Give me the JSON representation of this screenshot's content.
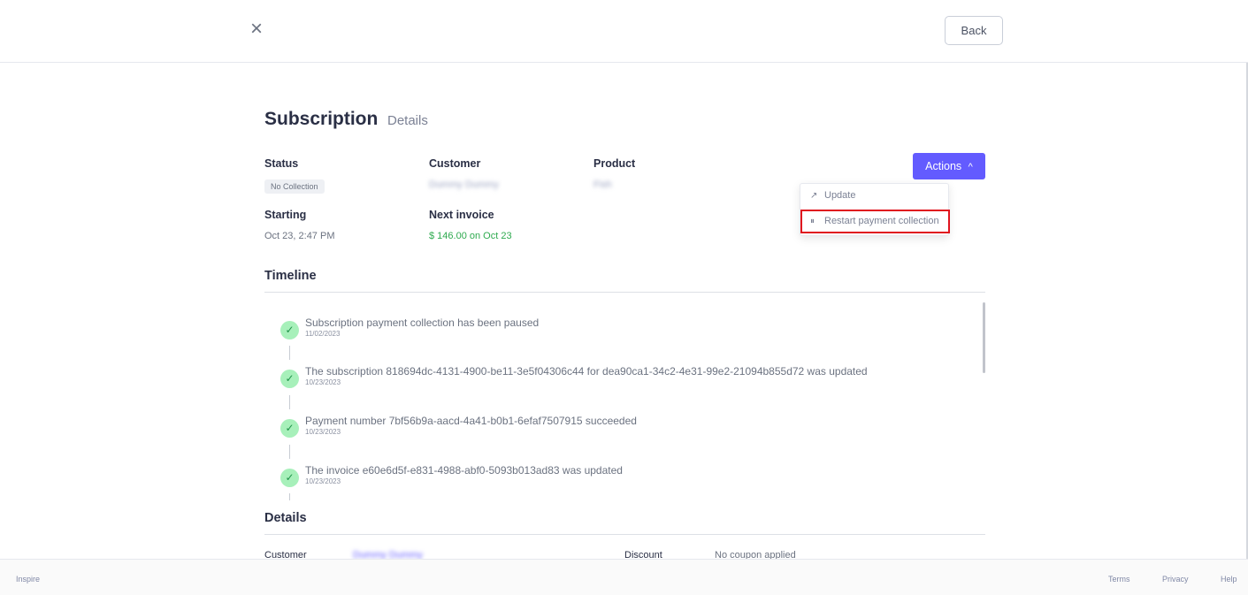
{
  "header": {
    "close_icon": "×",
    "back_label": "Back"
  },
  "page": {
    "title": "Subscription",
    "subtitle": "Details"
  },
  "fields": {
    "status": {
      "label": "Status",
      "value": "No Collection"
    },
    "customer": {
      "label": "Customer",
      "value": "Dummy Dummy"
    },
    "product": {
      "label": "Product",
      "value": "Fish"
    },
    "starting": {
      "label": "Starting",
      "value": "Oct 23, 2:47 PM"
    },
    "next_invoice": {
      "label": "Next invoice",
      "value": "$ 146.00 on Oct 23"
    }
  },
  "actions": {
    "button_label": "Actions",
    "chevron_icon": "^",
    "items": [
      {
        "icon": "↗",
        "label": "Update"
      },
      {
        "icon": "⏸",
        "label": "Restart payment collection"
      }
    ]
  },
  "timeline": {
    "title": "Timeline",
    "events": [
      {
        "text": "Subscription payment collection has been paused",
        "date": "11/02/2023"
      },
      {
        "text": "The subscription 818694dc-4131-4900-be11-3e5f04306c44 for dea90ca1-34c2-4e31-99e2-21094b855d72 was updated",
        "date": "10/23/2023"
      },
      {
        "text": "Payment number 7bf56b9a-aacd-4a41-b0b1-6efaf7507915 succeeded",
        "date": "10/23/2023"
      },
      {
        "text": "The invoice e60e6d5f-e831-4988-abf0-5093b013ad83 was updated",
        "date": "10/23/2023"
      }
    ]
  },
  "details": {
    "title": "Details",
    "customer_label": "Customer",
    "customer_value": "Dummy Dummy",
    "discount_label": "Discount",
    "discount_value": "No coupon applied"
  },
  "footer": {
    "brand": "Inspire",
    "links": [
      "Terms",
      "Privacy",
      "Help"
    ]
  },
  "colors": {
    "accent": "#635bff",
    "success": "#2eaa4f",
    "highlight_border": "#e0141e"
  }
}
